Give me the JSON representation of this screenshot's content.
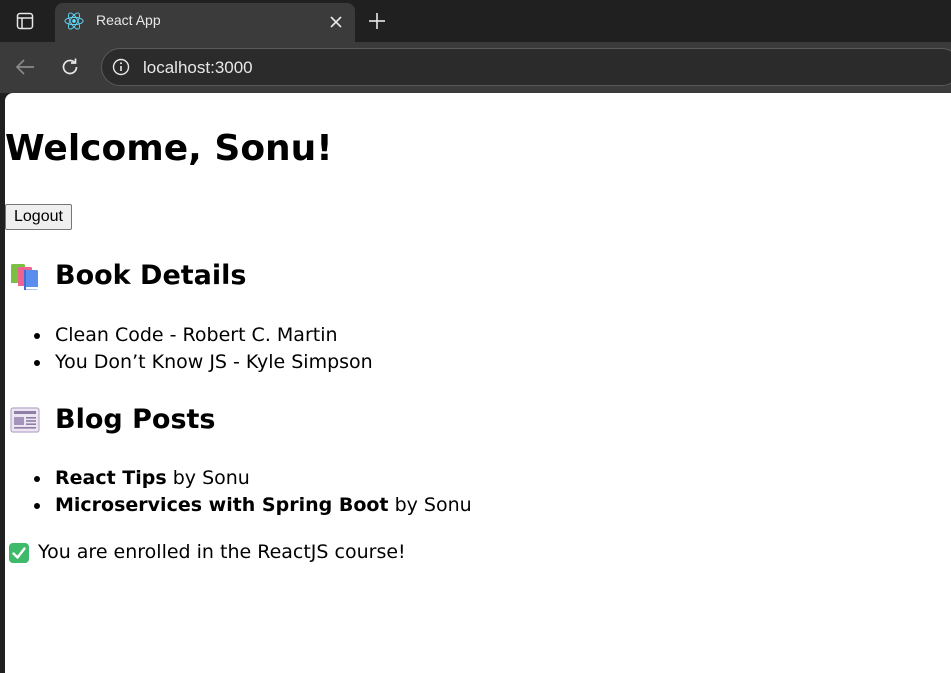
{
  "browser": {
    "tab": {
      "title": "React App",
      "favicon": "react-logo-icon"
    },
    "address_bar": {
      "url": "localhost:3000"
    },
    "icons": {
      "tab_actions": "tab-actions-icon",
      "close": "close-icon",
      "new_tab": "plus-icon",
      "back": "back-arrow-icon",
      "reload": "reload-icon",
      "site_info": "info-icon"
    },
    "colors": {
      "frame": "#202020",
      "active_tab": "#3b3b3b",
      "react_blue": "#61dafb"
    }
  },
  "page": {
    "welcome": "Welcome, Sonu!",
    "logout_label": "Logout",
    "books": {
      "icon": "books-icon",
      "heading": "Book Details",
      "items": [
        "Clean Code - Robert C. Martin",
        "You Don’t Know JS - Kyle Simpson"
      ]
    },
    "blog": {
      "icon": "newspaper-icon",
      "heading": "Blog Posts",
      "items": [
        {
          "title": "React Tips",
          "byline": "by Sonu"
        },
        {
          "title": "Microservices with Spring Boot",
          "byline": "by Sonu"
        }
      ]
    },
    "enrollment": {
      "icon": "check-mark-icon",
      "text": "You are enrolled in the ReactJS course!"
    }
  }
}
